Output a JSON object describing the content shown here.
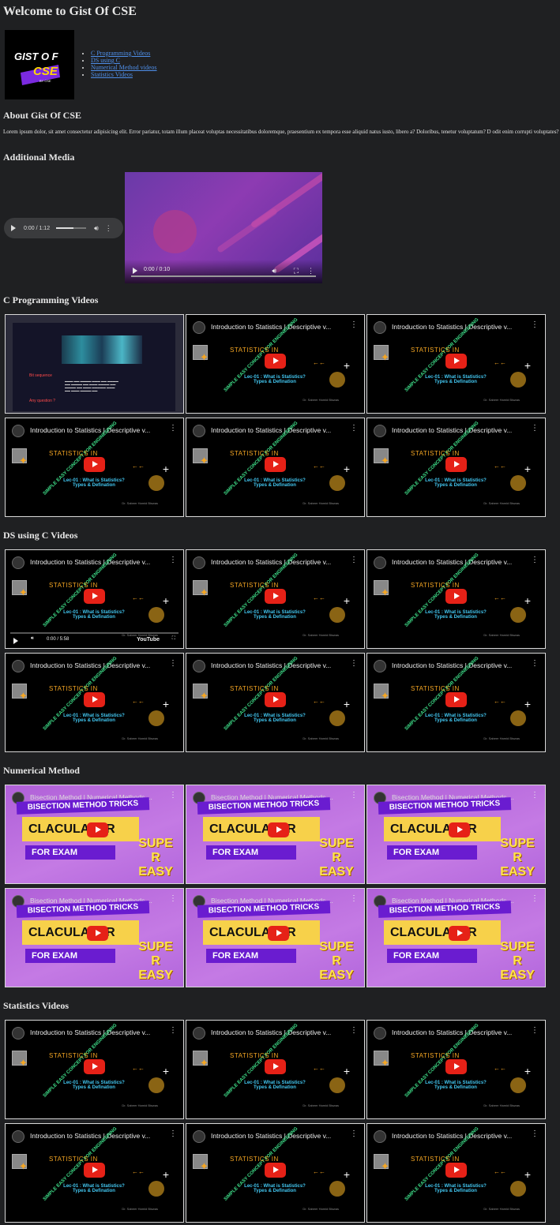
{
  "header": {
    "title": "Welcome to Gist Of CSE"
  },
  "logo": {
    "line1": "GIST O F",
    "line2": "CSE",
    "line3": "BY CSE"
  },
  "nav": {
    "items": [
      {
        "label": "C Programming Videos"
      },
      {
        "label": "DS using C"
      },
      {
        "label": "Numerical Method videos"
      },
      {
        "label": "Statistics Videos"
      }
    ]
  },
  "about": {
    "heading": "About Gist Of CSE",
    "text": "Lorem ipsum dolor, sit amet consectetur adipisicing elit. Error pariatur, totam illum placeat voluptas necessitatibus doloremque, praesentium ex tempora esse aliquid natus iusto, libero a? Doloribus, tenetur voluptatum? D odit enim corrupti voluptates?"
  },
  "media": {
    "heading": "Additional Media",
    "audio_time": "0:00 / 1:12",
    "video_time": "0:00 / 0:10"
  },
  "sections": {
    "c_programming": {
      "heading": "C Programming Videos"
    },
    "ds_using_c": {
      "heading": "DS using C Videos"
    },
    "numerical": {
      "heading": "Numerical Method"
    },
    "statistics": {
      "heading": "Statistics Videos"
    }
  },
  "videos": {
    "stat_title": "Introduction to Statistics | Descriptive v...",
    "bisection_title": "Bisection Method | Numerical Methods ...",
    "stat_thumb": {
      "big": "STATISTICS IN",
      "diag": "SIMPLE EASY CONCEPT FOR ENGINEERING",
      "lec1": "Lec-01 : What is Statistics?",
      "lec2": "Types & Defination",
      "credit": "Dr. Sabeer Hamid Biswas",
      "arrows": "←←"
    },
    "bisection_thumb": {
      "t1": "BISECTION METHOD TRICKS",
      "t2": "CLACULATOR",
      "t3": "FOR EXAM",
      "t4a": "SUPE",
      "t4b": "R",
      "t4c": "EASY"
    },
    "ds_player_time": "0:00 / 5:58",
    "ds_player_brand": "YouTube",
    "code_thumb": {
      "note1": "Bit sequence",
      "note2": "Any question ?"
    }
  },
  "colors": {
    "background": "#1f2022",
    "link": "#4e8ee8",
    "youtube_red": "#e62117"
  }
}
